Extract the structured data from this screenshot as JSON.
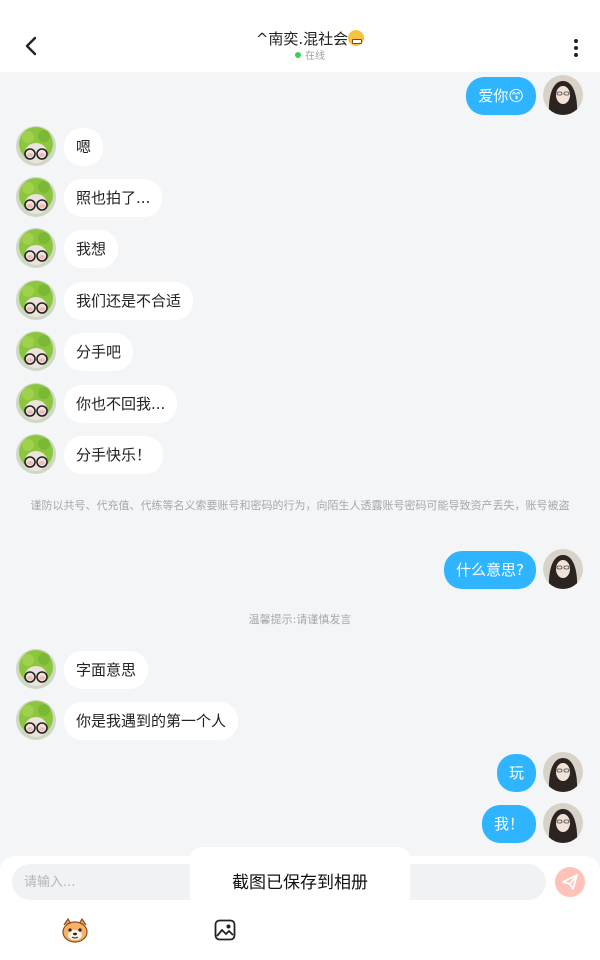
{
  "header": {
    "title": "^南奕.混社会",
    "status": "在线"
  },
  "messages": [
    {
      "side": "right",
      "text": "爱你😙"
    },
    {
      "side": "left",
      "text": "嗯"
    },
    {
      "side": "left",
      "text": "照也拍了..."
    },
    {
      "side": "left",
      "text": "我想"
    },
    {
      "side": "left",
      "text": "我们还是不合适"
    },
    {
      "side": "left",
      "text": "分手吧"
    },
    {
      "side": "left",
      "text": "你也不回我..."
    },
    {
      "side": "left",
      "text": "分手快乐！"
    },
    {
      "side": "right",
      "text": "什么意思?"
    },
    {
      "side": "left",
      "text": "字面意思"
    },
    {
      "side": "left",
      "text": "你是我遇到的第一个人"
    },
    {
      "side": "right",
      "text": "玩"
    },
    {
      "side": "right",
      "text": "我！"
    }
  ],
  "notice": "谨防以共号、代充值、代练等名义索要账号和密码的行为，向陌生人透露账号密码可能导致资产丢失，账号被盗",
  "tip": "温馨提示:请谨慎发言",
  "input": {
    "placeholder": "请输入..."
  },
  "toast": "截图已保存到相册",
  "colors": {
    "accent": "#2fb5ff",
    "background": "#f4f5f7",
    "send": "#ffc2b8",
    "online": "#3ccf5c"
  },
  "icons": {
    "back": "back-arrow-icon",
    "more": "more-vertical-icon",
    "send": "send-icon",
    "emoji": "emoji-icon",
    "image": "image-icon"
  }
}
